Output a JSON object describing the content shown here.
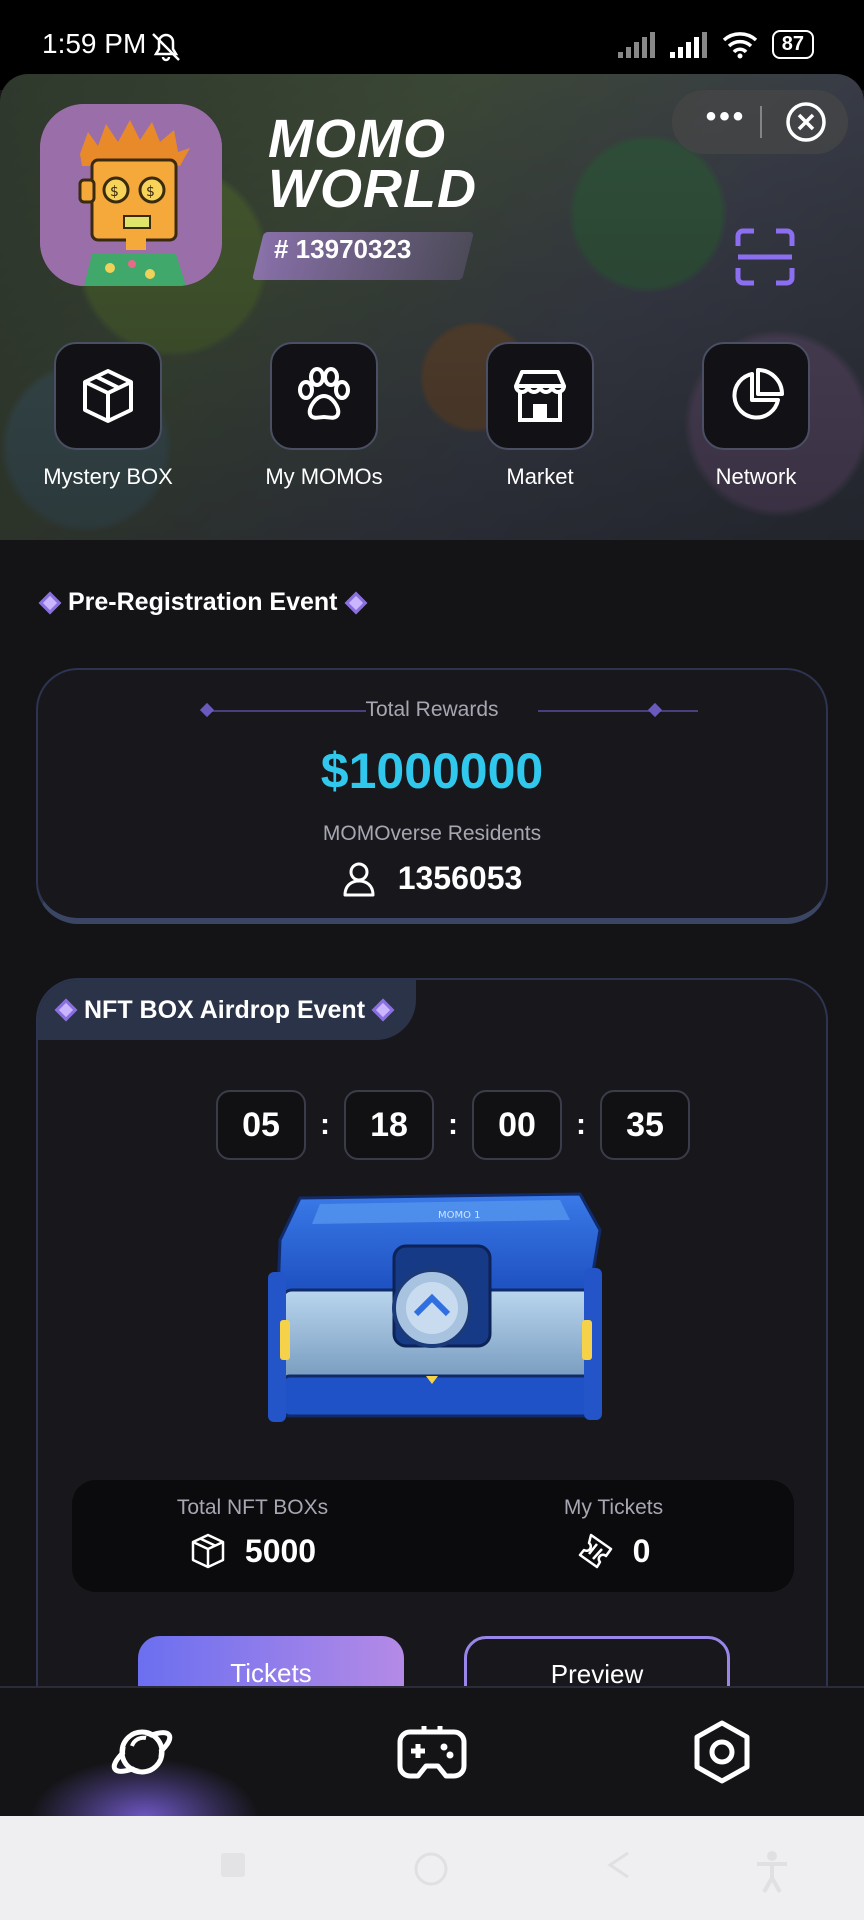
{
  "status_bar": {
    "time": "1:59 PM",
    "battery": "87",
    "icons": [
      "bell-muted-icon",
      "signal-icon",
      "signal-icon",
      "wifi-icon",
      "battery-icon"
    ]
  },
  "header": {
    "brand_line1": "MOMO",
    "brand_line2": "WORLD",
    "user_id": "# 13970323",
    "more_label": "•••"
  },
  "nav": [
    {
      "label": "Mystery BOX",
      "icon": "box-icon"
    },
    {
      "label": "My MOMOs",
      "icon": "paw-icon"
    },
    {
      "label": "Market",
      "icon": "store-icon"
    },
    {
      "label": "Network",
      "icon": "pie-chart-icon"
    }
  ],
  "pre_registration": {
    "title": "Pre-Registration Event",
    "total_rewards_label": "Total Rewards",
    "total_rewards": "$1000000",
    "residents_label": "MOMOverse Residents",
    "residents": "1356053"
  },
  "nft_event": {
    "title": "NFT BOX Airdrop Event",
    "countdown": [
      "05",
      "18",
      "00",
      "35"
    ],
    "separator": ":",
    "chest_label": "MOMO 1",
    "total_boxes_label": "Total NFT BOXs",
    "total_boxes": "5000",
    "my_tickets_label": "My Tickets",
    "my_tickets": "0",
    "tickets_button": "Tickets",
    "preview_button": "Preview"
  },
  "bottom_nav": [
    {
      "icon": "planet-icon",
      "active": true
    },
    {
      "icon": "gamepad-icon",
      "active": false
    },
    {
      "icon": "settings-icon",
      "active": false
    }
  ],
  "colors": {
    "accent_cyan": "#30c8ec",
    "accent_purple": "#9a86e8",
    "background": "#141417"
  }
}
